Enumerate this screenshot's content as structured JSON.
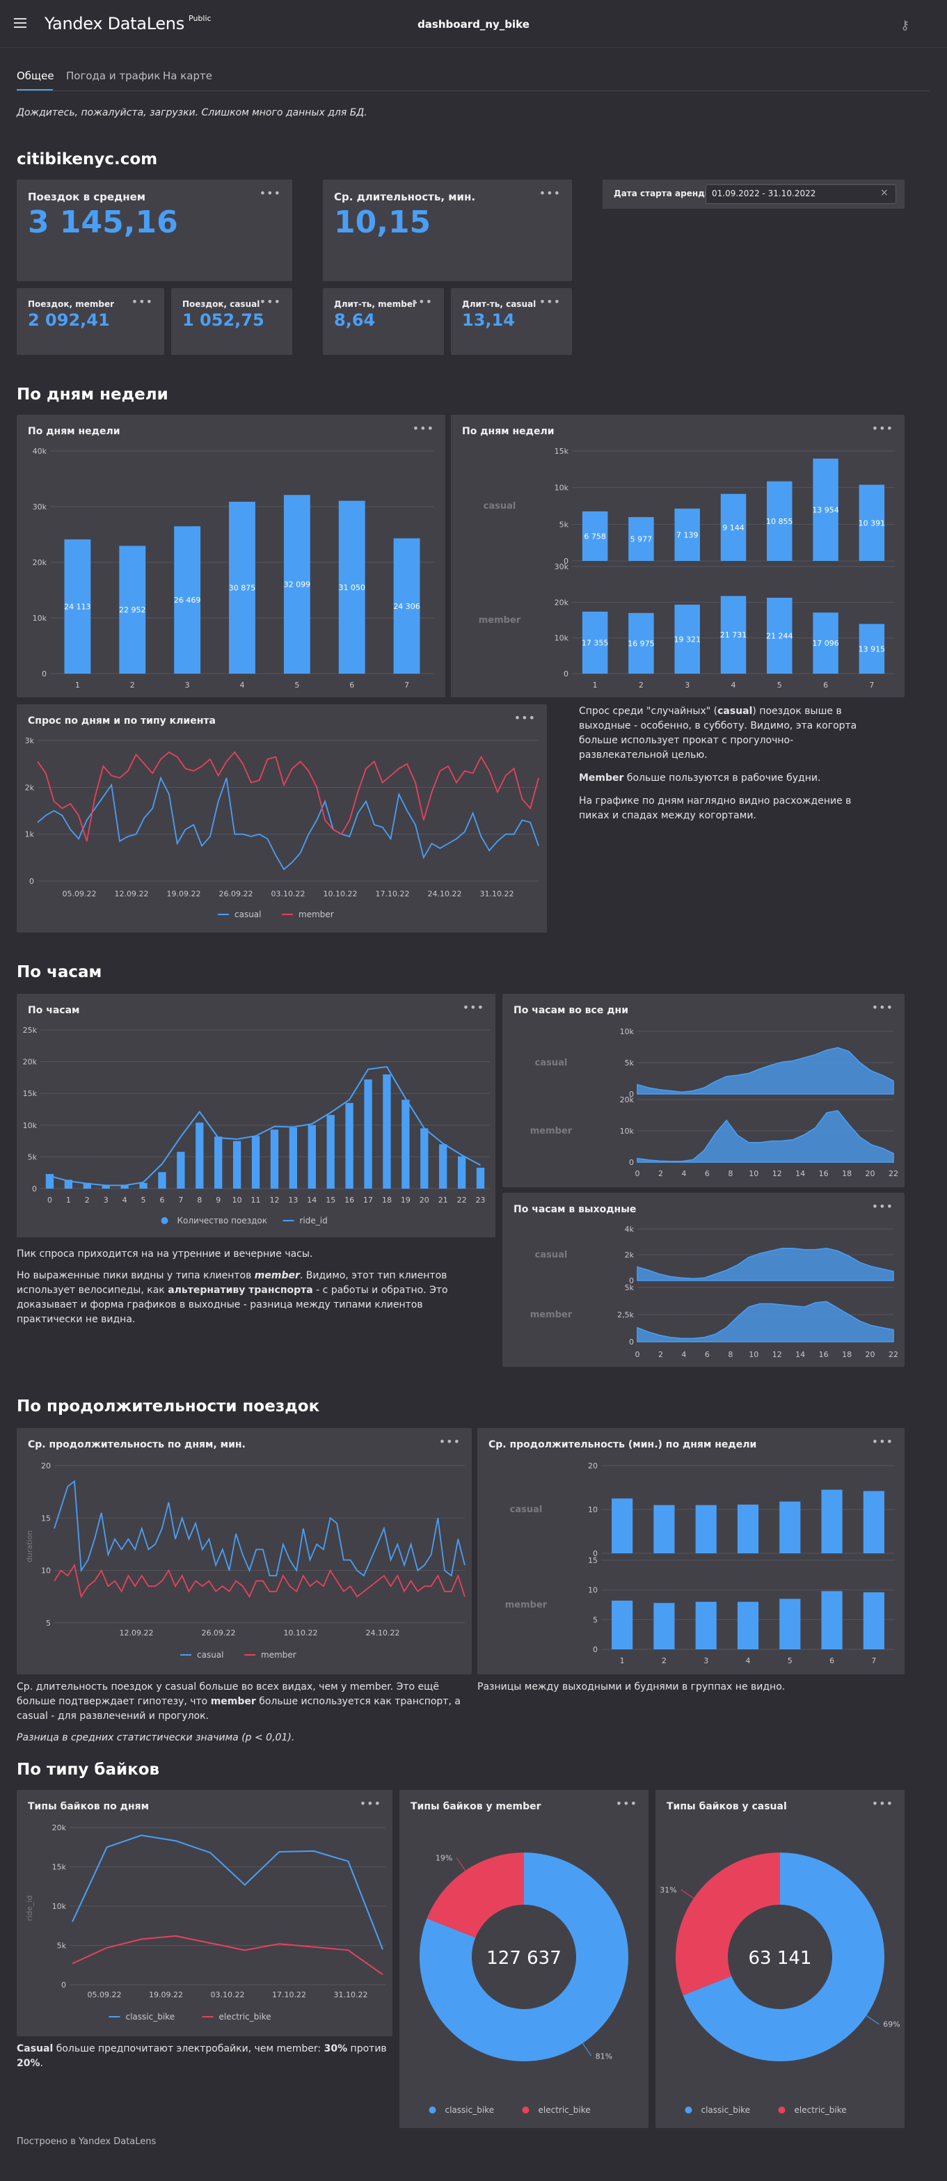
{
  "header": {
    "brand": "Yandex DataLens",
    "brand_badge": "Public",
    "title": "dashboard_ny_bike"
  },
  "tabs": [
    {
      "label": "Общее"
    },
    {
      "label": "Погода и трафик"
    },
    {
      "label": "На карте"
    }
  ],
  "loading_note": "Дождитесь, пожалуйста, загрузки. Слишком много данных для БД.",
  "section_site": "citibikenyc.com",
  "kpi": {
    "avg_trips": {
      "label": "Поездок в среднем",
      "value": "3 145,16"
    },
    "avg_duration": {
      "label": "Ср. длительность, мин.",
      "value": "10,15"
    },
    "member_trips": {
      "label": "Поездок, member",
      "value": "2 092,41"
    },
    "casual_trips": {
      "label": "Поездок, casual",
      "value": "1 052,75"
    },
    "member_dur": {
      "label": "Длит-ть, member",
      "value": "8,64"
    },
    "casual_dur": {
      "label": "Длит-ть, casual",
      "value": "13,14"
    }
  },
  "filter": {
    "label": "Дата старта аренды",
    "value": "01.09.2022 - 31.10.2022"
  },
  "colors": {
    "accent": "#4a9ff5",
    "member": "#e8415c",
    "casual": "#4a9ff5",
    "card": "#424148",
    "bg": "#2e2d33"
  },
  "sections": {
    "weekdays": "По дням недели",
    "hours": "По часам",
    "duration": "По продолжительности поездок",
    "bike_types": "По типу байков"
  },
  "card_titles": {
    "wd_total": "По дням недели",
    "wd_split": "По дням недели",
    "demand": "Спрос по дням и по типу клиента",
    "hours": "По часам",
    "hours_all": "По часам во все дни",
    "hours_weekend": "По часам в выходные",
    "dur_days": "Ср. продолжительность по дням, мин.",
    "dur_weekdays": "Ср. продолжительность (мин.) по дням недели",
    "types_days": "Типы байков по дням",
    "types_member": "Типы байков у member",
    "types_casual": "Типы байков у casual"
  },
  "notes": {
    "demand_p1a": "Спрос среди \"случайных\" (",
    "demand_p1b": "casual",
    "demand_p1c": ") поездок выше в выходные - особенно, в субботу. Видимо, эта когорта больше использует прокат с прогулочно-развлекательной целью.",
    "demand_p2a": "Member",
    "demand_p2b": " больше пользуются в рабочие будни.",
    "demand_p3": "На графике по дням наглядно видно расхождение в пиках и спадах между когортами.",
    "hours_p1": "Пик спроса приходится на на утренние и вечерние часы.",
    "hours_p2a": "Но выраженные пики видны у типа клиентов ",
    "hours_p2b": "member",
    "hours_p2c": ". Видимо, этот тип клиентов использует велосипеды, как ",
    "hours_p2d": "альтернативу транспорта",
    "hours_p2e": " - с работы и обратно. Это доказывает и форма графиков в выходные - разница между типами клиентов практически не видна.",
    "dur_p1a": "Ср. длительность поездок у casual больше во всех видах, чем у member. Это ещё больше подтверждает гипотезу, что ",
    "dur_p1b": "member",
    "dur_p1c": " больше используется как транспорт, а casual - для развлечений и прогулок.",
    "dur_p2": "Разница в средних статистически значима (p < 0,01).",
    "dur_right": "Разницы между выходными и буднями в группах не видно.",
    "types_a": "Casual",
    "types_b": " больше предпочитают электробайки, чем member: ",
    "types_c": "30%",
    "types_d": " против ",
    "types_e": "20%",
    "types_f": "."
  },
  "footer": "Построено в Yandex DataLens",
  "chart_data": [
    {
      "id": "wd_total",
      "type": "bar",
      "categories": [
        "1",
        "2",
        "3",
        "4",
        "5",
        "6",
        "7"
      ],
      "values": [
        24113,
        22952,
        26469,
        30875,
        32099,
        31050,
        24306
      ],
      "labels": [
        "24 113",
        "22 952",
        "26 469",
        "30 875",
        "32 099",
        "31 050",
        "24 306"
      ],
      "ylim": [
        0,
        40000
      ],
      "yticks": [
        "0",
        "10k",
        "20k",
        "30k",
        "40k"
      ]
    },
    {
      "id": "wd_split",
      "type": "bar",
      "categories": [
        "1",
        "2",
        "3",
        "4",
        "5",
        "6",
        "7"
      ],
      "series": [
        {
          "name": "casual",
          "values": [
            6758,
            5977,
            7139,
            9144,
            10855,
            13954,
            10391
          ],
          "labels": [
            "6 758",
            "5 977",
            "7 139",
            "9 144",
            "10 855",
            "13 954",
            "10 391"
          ],
          "ylim": [
            0,
            15000
          ],
          "yticks": [
            "0",
            "5k",
            "10k",
            "15k"
          ]
        },
        {
          "name": "member",
          "values": [
            17355,
            16975,
            19321,
            21731,
            21244,
            17096,
            13915
          ],
          "labels": [
            "17 355",
            "16 975",
            "19 321",
            "21 731",
            "21 244",
            "17 096",
            "13 915"
          ],
          "ylim": [
            0,
            30000
          ],
          "yticks": [
            "0",
            "10k",
            "20k",
            "30k"
          ]
        }
      ]
    },
    {
      "id": "demand",
      "type": "line",
      "xticks": [
        "05.09.22",
        "12.09.22",
        "19.09.22",
        "26.09.22",
        "03.10.22",
        "10.10.22",
        "17.10.22",
        "24.10.22",
        "31.10.22"
      ],
      "ylim": [
        0,
        3000
      ],
      "yticks": [
        "0",
        "1k",
        "2k",
        "3k"
      ],
      "series": [
        {
          "name": "casual",
          "values": [
            1250,
            1400,
            1500,
            1400,
            1100,
            900,
            1300,
            1550,
            1800,
            2050,
            850,
            950,
            1000,
            1350,
            1550,
            2200,
            1850,
            800,
            1100,
            1200,
            750,
            950,
            1700,
            2200,
            1000,
            1000,
            950,
            1000,
            900,
            550,
            250,
            400,
            600,
            1000,
            1300,
            1700,
            1100,
            1000,
            950,
            1450,
            1700,
            1200,
            1150,
            900,
            1850,
            1500,
            1200,
            500,
            800,
            700,
            800,
            900,
            1050,
            1450,
            950,
            650,
            850,
            1000,
            1000,
            1300,
            1250,
            750
          ]
        },
        {
          "name": "member",
          "values": [
            2550,
            2300,
            1700,
            1550,
            1650,
            1400,
            850,
            1800,
            2450,
            2250,
            2200,
            2350,
            2700,
            2500,
            2300,
            2600,
            2750,
            2650,
            2400,
            2350,
            2450,
            2600,
            2250,
            2550,
            2750,
            2500,
            2100,
            2150,
            2600,
            2650,
            2050,
            2400,
            2550,
            2350,
            2000,
            1300,
            1100,
            1000,
            1300,
            1900,
            2400,
            2550,
            2100,
            2250,
            2400,
            2500,
            2100,
            1300,
            1900,
            2350,
            2450,
            2100,
            2350,
            2300,
            2650,
            2350,
            1900,
            2250,
            2400,
            1750,
            1550,
            2200
          ]
        }
      ]
    },
    {
      "id": "hours",
      "type": "bar",
      "categories": [
        "0",
        "1",
        "2",
        "3",
        "4",
        "5",
        "6",
        "7",
        "8",
        "9",
        "10",
        "11",
        "12",
        "13",
        "14",
        "15",
        "16",
        "17",
        "18",
        "19",
        "20",
        "21",
        "22",
        "23"
      ],
      "series": [
        {
          "name": "Количество поездок",
          "values": [
            2300,
            1400,
            900,
            600,
            500,
            900,
            2600,
            5800,
            10400,
            8200,
            7500,
            8300,
            9300,
            9600,
            10000,
            11600,
            13500,
            17200,
            18000,
            14000,
            9500,
            7000,
            5100,
            3300
          ]
        },
        {
          "name": "ride_id",
          "values": [
            2000,
            1200,
            800,
            500,
            500,
            1000,
            3900,
            8200,
            12100,
            8000,
            7800,
            8300,
            9800,
            9700,
            10200,
            12000,
            14000,
            18800,
            19200,
            14200,
            9500,
            7100,
            5300,
            3700
          ]
        }
      ],
      "ylim": [
        0,
        25000
      ],
      "yticks": [
        "0",
        "5k",
        "10k",
        "15k",
        "20k",
        "25k"
      ]
    },
    {
      "id": "hours_all",
      "type": "area",
      "x": [
        0,
        1,
        2,
        3,
        4,
        5,
        6,
        7,
        8,
        9,
        10,
        11,
        12,
        13,
        14,
        15,
        16,
        17,
        18,
        19,
        20,
        21,
        22,
        23
      ],
      "xticks": [
        "0",
        "2",
        "4",
        "6",
        "8",
        "10",
        "12",
        "14",
        "16",
        "18",
        "20",
        "22"
      ],
      "series": [
        {
          "name": "casual",
          "values": [
            1500,
            1000,
            700,
            500,
            300,
            500,
            1000,
            2000,
            2800,
            3000,
            3300,
            4000,
            4600,
            5100,
            5300,
            5800,
            6300,
            7000,
            7400,
            6800,
            5000,
            3700,
            3000,
            2100
          ],
          "ylim": [
            0,
            10000
          ],
          "yticks": [
            "0",
            "5k",
            "10k"
          ]
        },
        {
          "name": "member",
          "values": [
            1200,
            700,
            400,
            300,
            300,
            800,
            3800,
            9100,
            13400,
            8600,
            6300,
            6300,
            6700,
            6800,
            7200,
            8800,
            11000,
            15800,
            16500,
            12000,
            8000,
            5600,
            4500,
            2800
          ],
          "ylim": [
            0,
            20000
          ],
          "yticks": [
            "0",
            "10k",
            "20k"
          ]
        }
      ]
    },
    {
      "id": "hours_weekend",
      "type": "area",
      "x": [
        0,
        1,
        2,
        3,
        4,
        5,
        6,
        7,
        8,
        9,
        10,
        11,
        12,
        13,
        14,
        15,
        16,
        17,
        18,
        19,
        20,
        21,
        22,
        23
      ],
      "xticks": [
        "0",
        "2",
        "4",
        "6",
        "8",
        "10",
        "12",
        "14",
        "16",
        "18",
        "20",
        "22"
      ],
      "series": [
        {
          "name": "casual",
          "values": [
            1050,
            800,
            500,
            300,
            200,
            150,
            200,
            500,
            800,
            1200,
            1800,
            2100,
            2300,
            2500,
            2500,
            2400,
            2400,
            2500,
            2300,
            1900,
            1400,
            1100,
            900,
            700
          ],
          "ylim": [
            0,
            4000
          ],
          "yticks": [
            "0",
            "2k",
            "4k"
          ]
        },
        {
          "name": "member",
          "values": [
            1300,
            900,
            600,
            400,
            300,
            300,
            400,
            700,
            1300,
            2300,
            3200,
            3500,
            3500,
            3400,
            3300,
            3200,
            3600,
            3700,
            3100,
            2500,
            1900,
            1500,
            1300,
            1100
          ],
          "ylim": [
            0,
            5000
          ],
          "yticks": [
            "0",
            "2,5k",
            "5k"
          ]
        }
      ]
    },
    {
      "id": "dur_days",
      "type": "line",
      "xticks": [
        "12.09.22",
        "26.09.22",
        "10.10.22",
        "24.10.22"
      ],
      "ylabel": "duration",
      "ylim": [
        5,
        20
      ],
      "yticks": [
        "5",
        "10",
        "15",
        "20"
      ],
      "series": [
        {
          "name": "casual",
          "values": [
            14,
            16,
            18,
            18.5,
            10,
            11,
            13,
            15.5,
            11.5,
            13,
            12,
            13,
            12,
            14,
            12,
            12.5,
            14,
            16.5,
            13,
            15,
            13,
            14.5,
            12,
            13,
            10.5,
            12,
            10,
            13.5,
            11.5,
            10,
            12,
            12,
            9.5,
            9.5,
            12.5,
            11,
            10,
            14,
            11,
            12.5,
            12,
            15,
            14.5,
            11,
            11,
            10,
            9.5,
            11,
            12.5,
            14,
            11,
            12.5,
            10.5,
            12.5,
            10,
            10.5,
            11.5,
            15,
            10,
            9.5,
            13,
            10.5
          ]
        },
        {
          "name": "member",
          "values": [
            9,
            10,
            9.5,
            10.5,
            7.5,
            8.5,
            9,
            10,
            8.5,
            9,
            8,
            9.5,
            8.5,
            9.5,
            8.5,
            8.5,
            9,
            10,
            8.5,
            9.5,
            8,
            9,
            8.5,
            9,
            8,
            8.5,
            8,
            9,
            8.5,
            7.5,
            9,
            9,
            8,
            8,
            9.5,
            8.5,
            8,
            9.5,
            8.5,
            9,
            8.5,
            10,
            9,
            8,
            8.5,
            7.5,
            8,
            8.5,
            9,
            9.5,
            8.5,
            9.5,
            8,
            9,
            8,
            8.5,
            8.5,
            9.5,
            8,
            8,
            9.5,
            7.5
          ]
        }
      ]
    },
    {
      "id": "dur_weekdays",
      "type": "bar",
      "categories": [
        "1",
        "2",
        "3",
        "4",
        "5",
        "6",
        "7"
      ],
      "series": [
        {
          "name": "casual",
          "values": [
            12.5,
            11,
            11,
            11.1,
            11.8,
            14.5,
            14.2
          ],
          "ylim": [
            0,
            20
          ],
          "yticks": [
            "0",
            "10",
            "20"
          ]
        },
        {
          "name": "member",
          "values": [
            8.2,
            7.8,
            8,
            8,
            8.5,
            9.8,
            9.6
          ],
          "ylim": [
            0,
            15
          ],
          "yticks": [
            "0",
            "5",
            "10",
            "15"
          ]
        }
      ]
    },
    {
      "id": "types_days",
      "type": "line",
      "xticks": [
        "05.09.22",
        "19.09.22",
        "03.10.22",
        "17.10.22",
        "31.10.22"
      ],
      "ylabel": "ride_id",
      "ylim": [
        0,
        20000
      ],
      "yticks": [
        "0",
        "5k",
        "10k",
        "15k",
        "20k"
      ],
      "series": [
        {
          "name": "classic_bike",
          "values": [
            8000,
            17500,
            19000,
            18300,
            16800,
            12700,
            16900,
            17000,
            15700,
            4500
          ]
        },
        {
          "name": "electric_bike",
          "values": [
            2700,
            4700,
            5800,
            6200,
            5300,
            4400,
            5200,
            4800,
            4400,
            1300
          ]
        }
      ]
    },
    {
      "id": "types_member",
      "type": "pie",
      "total": "127 637",
      "slices": [
        {
          "name": "classic_bike",
          "value": 81,
          "label": "81%"
        },
        {
          "name": "electric_bike",
          "value": 19,
          "label": "19%"
        }
      ]
    },
    {
      "id": "types_casual",
      "type": "pie",
      "total": "63 141",
      "slices": [
        {
          "name": "classic_bike",
          "value": 69,
          "label": "69%"
        },
        {
          "name": "electric_bike",
          "value": 31,
          "label": "31%"
        }
      ]
    }
  ]
}
